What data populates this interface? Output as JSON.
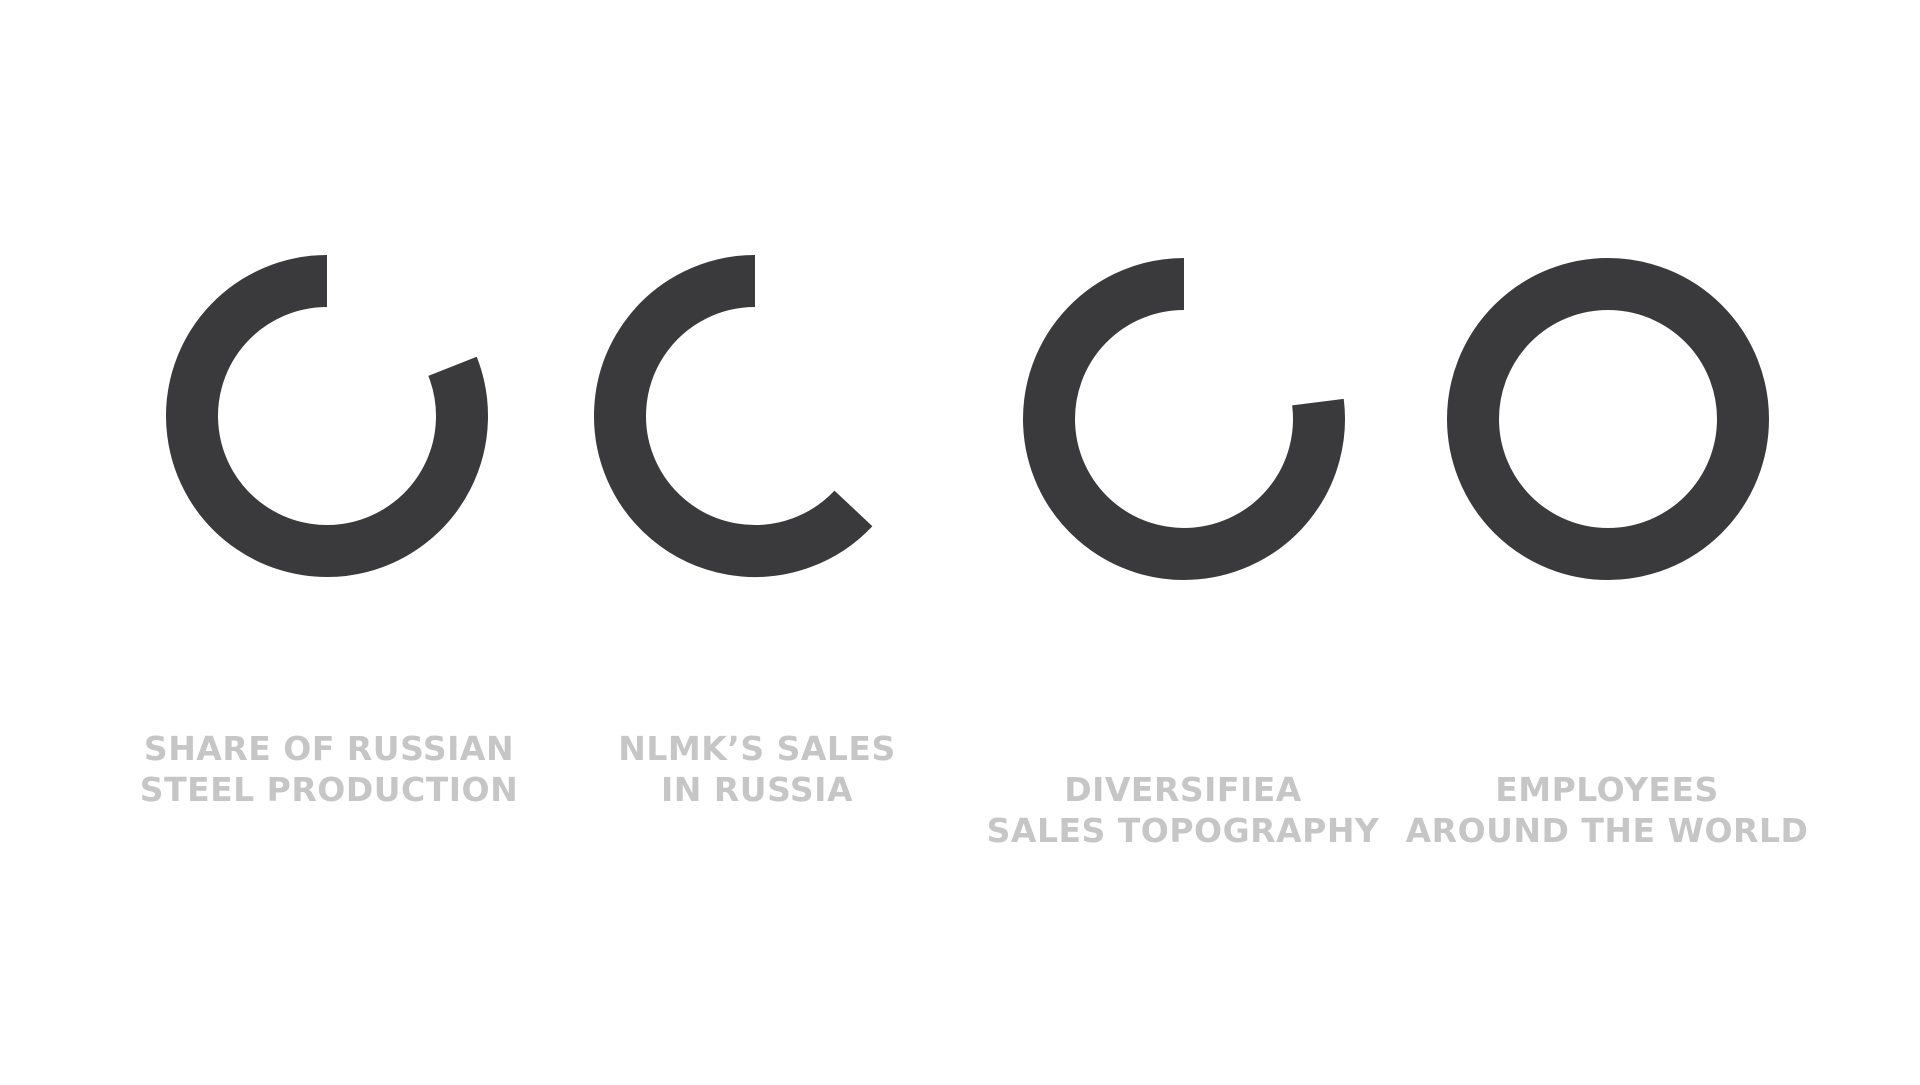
{
  "colors": {
    "ring": "#3a3a3c",
    "caption": "#c6c6c6",
    "background": "#ffffff"
  },
  "chart_data": [
    {
      "type": "pie",
      "style": "progress-ring",
      "value_fraction": 0.81,
      "caption_lines": [
        "SHARE OF RUSSIAN",
        "STEEL PRODUCTION"
      ]
    },
    {
      "type": "pie",
      "style": "progress-ring",
      "value_fraction": 0.63,
      "caption_lines": [
        "NLMK’S SALES",
        "IN RUSSIA"
      ]
    },
    {
      "type": "pie",
      "style": "progress-ring",
      "value_fraction": 0.77,
      "caption_lines": [
        "DIVERSIFIEA",
        "SALES TOPOGRAPHY"
      ]
    },
    {
      "type": "pie",
      "style": "progress-ring",
      "value_fraction": 1.0,
      "caption_lines": [
        "EMPLOYEES",
        "AROUND THE WORLD"
      ]
    }
  ]
}
